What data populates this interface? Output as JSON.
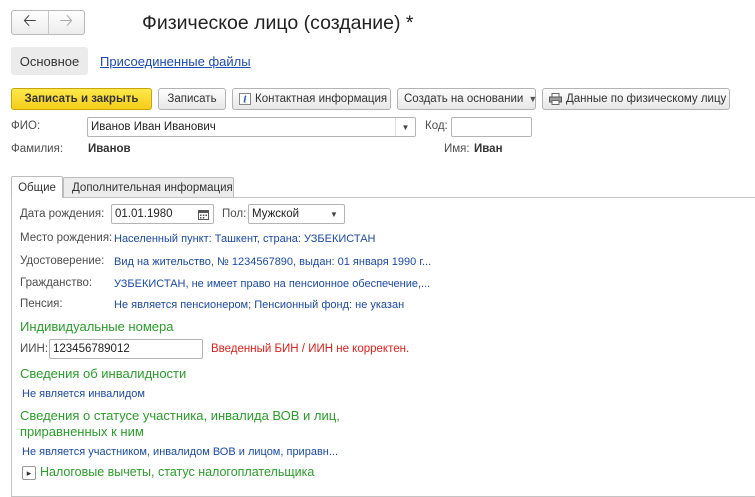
{
  "nav": {
    "back_icon": "arrow-left-icon",
    "forward_icon": "arrow-right-icon"
  },
  "window": {
    "title": "Физическое лицо (создание) *"
  },
  "top_tabs": {
    "main": "Основное",
    "files": "Присоединенные файлы"
  },
  "toolbar": {
    "save_close": "Записать и закрыть",
    "save": "Записать",
    "contact_info": "Контактная информация",
    "create_based": "Создать на основании",
    "person_data": "Данные по физическому лицу"
  },
  "header": {
    "fio_label": "ФИО:",
    "fio_value": "Иванов Иван Иванович",
    "code_label": "Код:",
    "code_value": "",
    "lastname_label": "Фамилия:",
    "lastname_value": "Иванов",
    "firstname_label": "Имя:",
    "firstname_value": "Иван"
  },
  "inner_tabs": {
    "general": "Общие",
    "additional": "Дополнительная информация"
  },
  "general": {
    "birthdate_label": "Дата рождения:",
    "birthdate_value": "01.01.1980",
    "gender_label": "Пол:",
    "gender_value": "Мужской",
    "birthplace_label": "Место рождения:",
    "birthplace_value": "Населенный пункт: Ташкент, страна: УЗБЕКИСТАН",
    "id_doc_label": "Удостоверение:",
    "id_doc_value": "Вид на жительство, № 1234567890, выдан: 01 января 1990 г...",
    "citizenship_label": "Гражданство:",
    "citizenship_value": "УЗБЕКИСТАН, не имеет право на пенсионное обеспечение,...",
    "pension_label": "Пенсия:",
    "pension_value": "Не является пенсионером; Пенсионный фонд: не указан",
    "indiv_numbers_header": "Индивидуальные номера",
    "iin_label": "ИИН:",
    "iin_value": "123456789012",
    "iin_error": "Введенный БИН / ИИН не корректен.",
    "disability_header": "Сведения об инвалидности",
    "disability_value": "Не является инвалидом",
    "wwii_header_line1": "Сведения о статусе участника, инвалида ВОВ и лиц,",
    "wwii_header_line2": "приравненных к ним",
    "wwii_value": "Не является участником, инвалидом ВОВ и лицом, приравн...",
    "tax_section": "Налоговые вычеты, статус налогоплательщика"
  },
  "colors": {
    "primary_button": "#f4cc1a",
    "link": "#1c4aa6",
    "section_header": "#2a9d2a",
    "error": "#e0201b"
  }
}
